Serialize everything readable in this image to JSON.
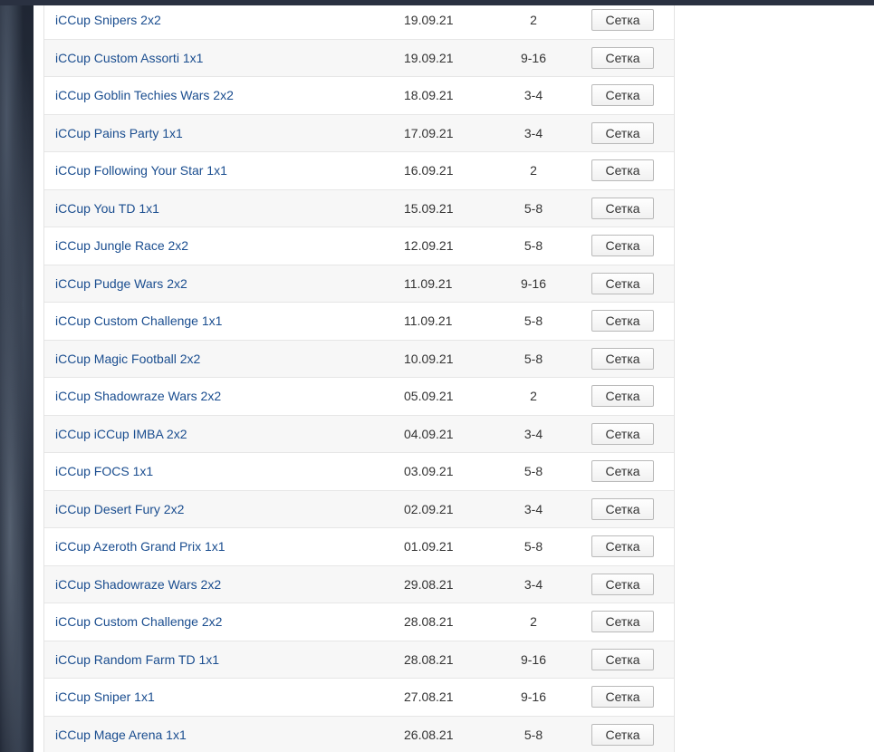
{
  "tournaments": [
    {
      "name": "iCCup Snipers 2x2",
      "date": "19.09.21",
      "place": "2",
      "button": "Сетка"
    },
    {
      "name": "iCCup Custom Assorti 1x1",
      "date": "19.09.21",
      "place": "9-16",
      "button": "Сетка"
    },
    {
      "name": "iCCup Goblin Techies Wars 2x2",
      "date": "18.09.21",
      "place": "3-4",
      "button": "Сетка"
    },
    {
      "name": "iCCup Pains Party 1x1",
      "date": "17.09.21",
      "place": "3-4",
      "button": "Сетка"
    },
    {
      "name": "iCCup Following Your Star 1x1",
      "date": "16.09.21",
      "place": "2",
      "button": "Сетка"
    },
    {
      "name": "iCCup You TD 1x1",
      "date": "15.09.21",
      "place": "5-8",
      "button": "Сетка"
    },
    {
      "name": "iCCup Jungle Race 2x2",
      "date": "12.09.21",
      "place": "5-8",
      "button": "Сетка"
    },
    {
      "name": "iCCup Pudge Wars 2x2",
      "date": "11.09.21",
      "place": "9-16",
      "button": "Сетка"
    },
    {
      "name": "iCCup Custom Challenge 1x1",
      "date": "11.09.21",
      "place": "5-8",
      "button": "Сетка"
    },
    {
      "name": "iCCup Magic Football 2x2",
      "date": "10.09.21",
      "place": "5-8",
      "button": "Сетка"
    },
    {
      "name": "iCCup Shadowraze Wars 2x2",
      "date": "05.09.21",
      "place": "2",
      "button": "Сетка"
    },
    {
      "name": "iCCup iCCup IMBA 2x2",
      "date": "04.09.21",
      "place": "3-4",
      "button": "Сетка"
    },
    {
      "name": "iCCup FOCS 1x1",
      "date": "03.09.21",
      "place": "5-8",
      "button": "Сетка"
    },
    {
      "name": "iCCup Desert Fury 2x2",
      "date": "02.09.21",
      "place": "3-4",
      "button": "Сетка"
    },
    {
      "name": "iCCup Azeroth Grand Prix 1x1",
      "date": "01.09.21",
      "place": "5-8",
      "button": "Сетка"
    },
    {
      "name": "iCCup Shadowraze Wars 2x2",
      "date": "29.08.21",
      "place": "3-4",
      "button": "Сетка"
    },
    {
      "name": "iCCup Custom Challenge 2x2",
      "date": "28.08.21",
      "place": "2",
      "button": "Сетка"
    },
    {
      "name": "iCCup Random Farm TD 1x1",
      "date": "28.08.21",
      "place": "9-16",
      "button": "Сетка"
    },
    {
      "name": "iCCup Sniper 1x1",
      "date": "27.08.21",
      "place": "9-16",
      "button": "Сетка"
    },
    {
      "name": "iCCup Mage Arena 1x1",
      "date": "26.08.21",
      "place": "5-8",
      "button": "Сетка"
    }
  ]
}
